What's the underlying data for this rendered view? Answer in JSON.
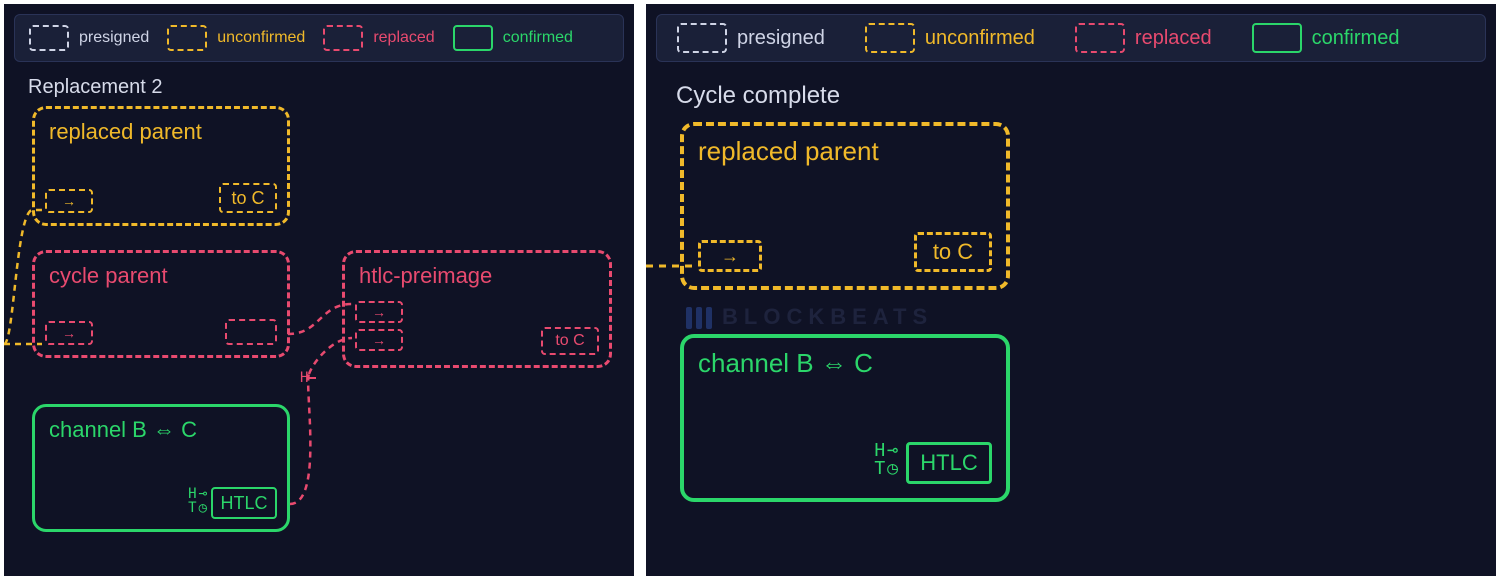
{
  "legend": {
    "presigned": "presigned",
    "unconfirmed": "unconfirmed",
    "replaced": "replaced",
    "confirmed": "confirmed"
  },
  "colors": {
    "presigned": "#cfd4e6",
    "unconfirmed": "#f0b92a",
    "replaced": "#e84a6f",
    "confirmed": "#2bd66a",
    "panel_bg": "#0f1225",
    "legend_bg": "#1a2038"
  },
  "watermark": "BLOCKBEATS",
  "left": {
    "title": "Replacement 2",
    "replaced_parent": {
      "label": "replaced parent",
      "output": "to C"
    },
    "cycle_parent": {
      "label": "cycle parent"
    },
    "htlc_preimage": {
      "label": "htlc-preimage",
      "output": "to C"
    },
    "channel": {
      "label": "channel B ⇔ C",
      "htlc_label": "HTLC"
    },
    "annotations": {
      "H": "H",
      "T": "T"
    },
    "wire_H_label": "H"
  },
  "right": {
    "title": "Cycle complete",
    "replaced_parent": {
      "label": "replaced parent",
      "output": "to C"
    },
    "channel": {
      "label": "channel B ⇔ C",
      "htlc_label": "HTLC"
    },
    "annotations": {
      "H": "H",
      "T": "T"
    }
  }
}
